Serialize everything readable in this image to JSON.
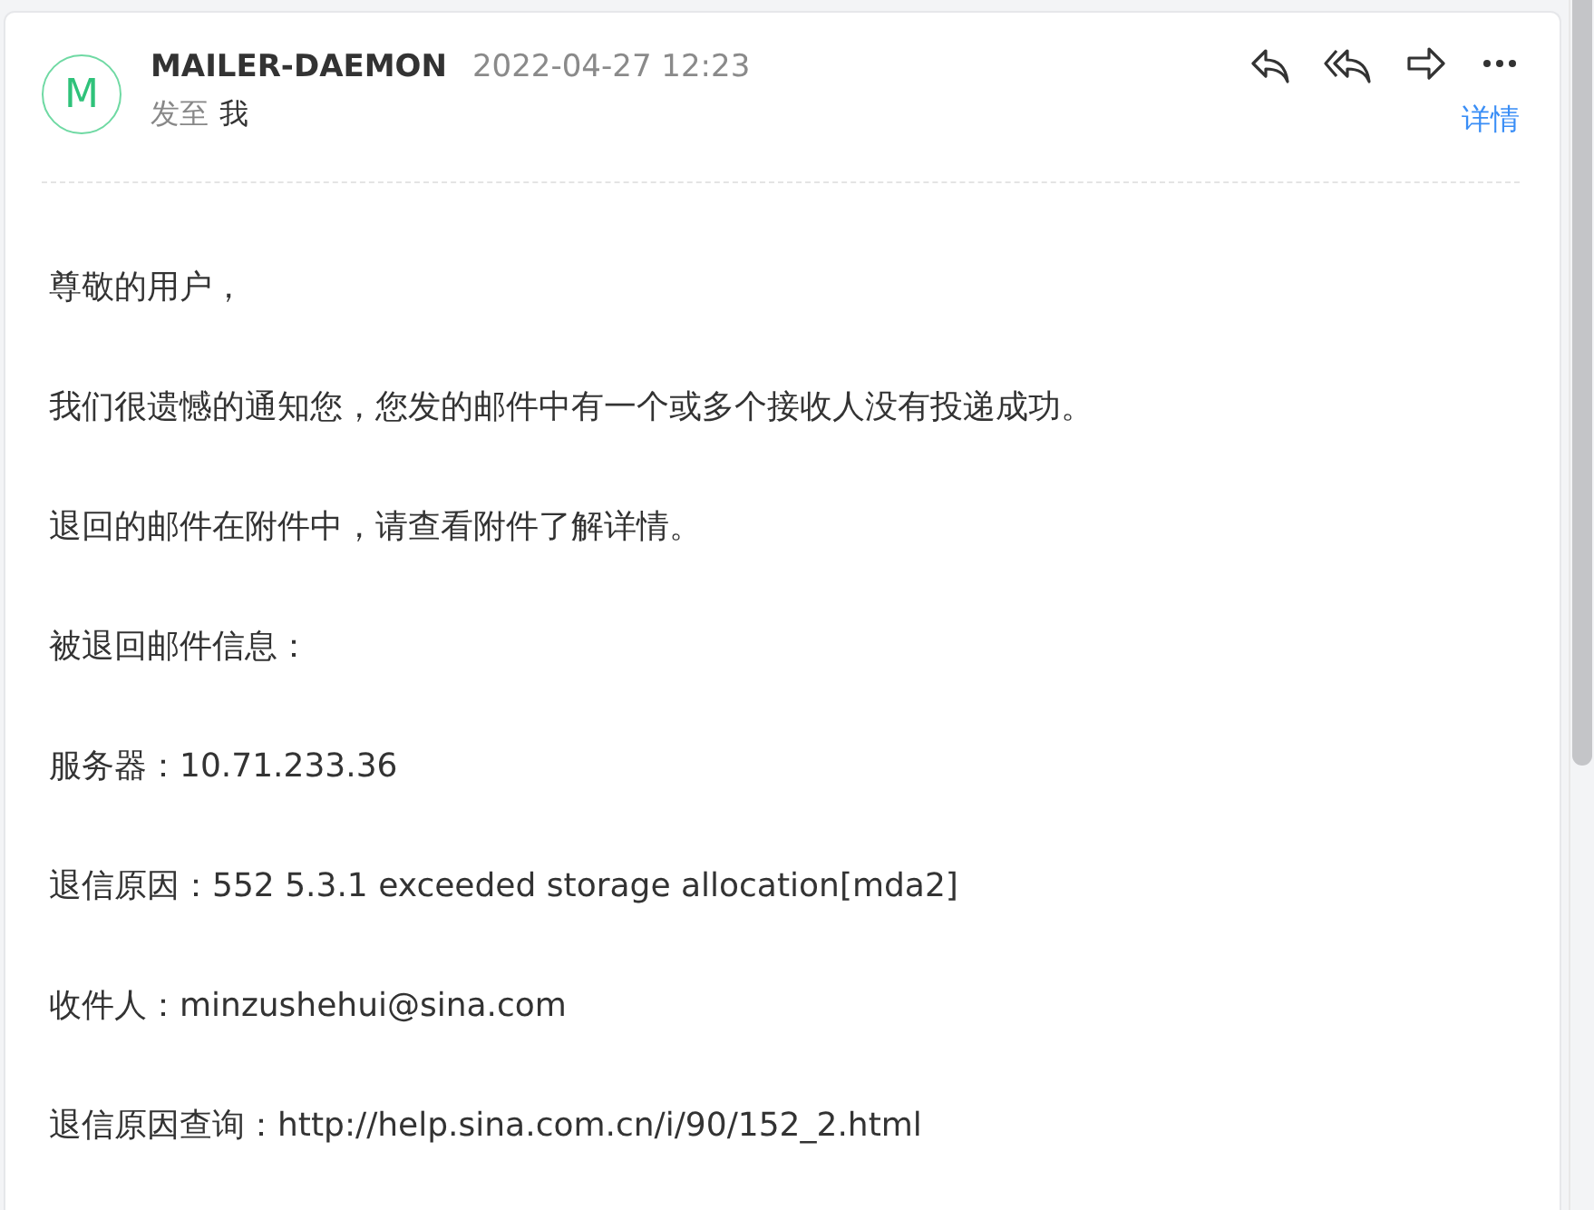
{
  "message": {
    "avatar": "M",
    "sender": "MAILER-DAEMON",
    "time": "2022-04-27 12:23",
    "to_label": "发至",
    "to": "我",
    "details_link": "详情",
    "actions": [
      {
        "kind": "reply"
      },
      {
        "kind": "reply_all"
      },
      {
        "kind": "forward"
      },
      {
        "kind": "more"
      }
    ],
    "body": [
      "尊敬的用户，",
      "我们很遗憾的通知您，您发的邮件中有一个或多个接收人没有投递成功。",
      "退回的邮件在附件中，请查看附件了解详情。",
      "被退回邮件信息：",
      "服务器：10.71.233.36",
      "退信原因：552 5.3.1 exceeded storage allocation[mda2]",
      "收件人：minzushehui@sina.com",
      "退信原因查询：http://help.sina.com.cn/i/90/152_2.html"
    ]
  }
}
